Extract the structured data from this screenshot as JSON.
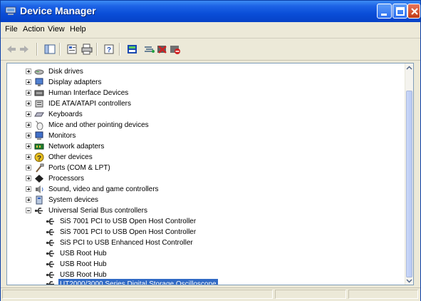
{
  "window": {
    "title": "Device Manager"
  },
  "menu": [
    "File",
    "Action",
    "View",
    "Help"
  ],
  "toolbar": [
    "back-icon",
    "forward-icon",
    "show-hide-console-tree-icon",
    "properties-icon",
    "print-icon",
    "help-icon",
    "update-driver-icon",
    "scan-hardware-icon",
    "uninstall-icon",
    "disable-icon"
  ],
  "tree": {
    "items": [
      {
        "label": "Disk drives",
        "icon": "disk-drive-icon",
        "state": "collapsed"
      },
      {
        "label": "Display adapters",
        "icon": "display-adapter-icon",
        "state": "collapsed"
      },
      {
        "label": "Human Interface Devices",
        "icon": "hid-icon",
        "state": "collapsed"
      },
      {
        "label": "IDE ATA/ATAPI controllers",
        "icon": "ide-controller-icon",
        "state": "collapsed"
      },
      {
        "label": "Keyboards",
        "icon": "keyboard-icon",
        "state": "collapsed"
      },
      {
        "label": "Mice and other pointing devices",
        "icon": "mouse-icon",
        "state": "collapsed"
      },
      {
        "label": "Monitors",
        "icon": "monitor-icon",
        "state": "collapsed"
      },
      {
        "label": "Network adapters",
        "icon": "network-adapter-icon",
        "state": "collapsed"
      },
      {
        "label": "Other devices",
        "icon": "other-devices-icon",
        "state": "collapsed"
      },
      {
        "label": "Ports (COM & LPT)",
        "icon": "ports-icon",
        "state": "collapsed"
      },
      {
        "label": "Processors",
        "icon": "processor-icon",
        "state": "collapsed"
      },
      {
        "label": "Sound, video and game controllers",
        "icon": "sound-icon",
        "state": "collapsed"
      },
      {
        "label": "System devices",
        "icon": "system-devices-icon",
        "state": "collapsed"
      },
      {
        "label": "Universal Serial Bus controllers",
        "icon": "usb-icon",
        "state": "expanded"
      }
    ],
    "usb_children": [
      {
        "label": "SiS 7001 PCI to USB Open Host Controller",
        "icon": "usb-icon"
      },
      {
        "label": "SiS 7001 PCI to USB Open Host Controller",
        "icon": "usb-icon"
      },
      {
        "label": "SiS PCI to USB Enhanced Host Controller",
        "icon": "usb-icon"
      },
      {
        "label": "USB Root Hub",
        "icon": "usb-icon"
      },
      {
        "label": "USB Root Hub",
        "icon": "usb-icon"
      },
      {
        "label": "USB Root Hub",
        "icon": "usb-icon"
      },
      {
        "label": "UT2000/3000 Series Digital Storage Oscilloscope",
        "icon": "usb-icon",
        "selected": true
      }
    ]
  },
  "colors": {
    "titlebar": "#0a4ed8",
    "selection": "#316ac5",
    "window_face": "#ece9d8"
  }
}
